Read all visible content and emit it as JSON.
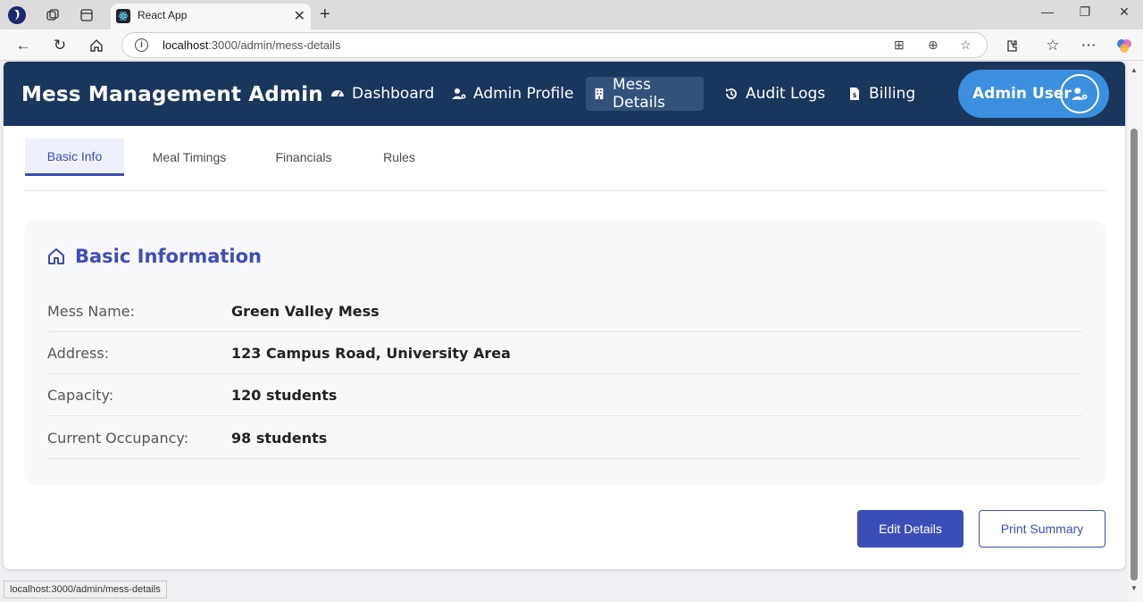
{
  "browser": {
    "tab_title": "React App",
    "url_host": "localhost",
    "url_rest": ":3000/admin/mess-details",
    "status_url": "localhost:3000/admin/mess-details"
  },
  "app": {
    "brand": "Mess Management Admin",
    "nav": [
      {
        "label": "Dashboard",
        "icon": "gauge-icon"
      },
      {
        "label": "Admin Profile",
        "icon": "user-gear-icon"
      },
      {
        "label": "Mess Details",
        "icon": "building-icon",
        "active": true
      },
      {
        "label": "Audit Logs",
        "icon": "history-icon"
      },
      {
        "label": "Billing",
        "icon": "invoice-icon"
      }
    ],
    "user": {
      "name": "Admin User",
      "icon": "user-gear-icon"
    }
  },
  "subtabs": [
    {
      "label": "Basic Info",
      "active": true
    },
    {
      "label": "Meal Timings"
    },
    {
      "label": "Financials"
    },
    {
      "label": "Rules"
    }
  ],
  "basic_info": {
    "title": "Basic Information",
    "rows": [
      {
        "label": "Mess Name:",
        "value": "Green Valley Mess"
      },
      {
        "label": "Address:",
        "value": "123 Campus Road, University Area"
      },
      {
        "label": "Capacity:",
        "value": "120 students"
      },
      {
        "label": "Current Occupancy:",
        "value": "98 students"
      }
    ]
  },
  "actions": {
    "edit": "Edit Details",
    "print": "Print Summary"
  },
  "colors": {
    "header": "#1b365d",
    "accent": "#3d4db7",
    "user_pill": "#3b8fde"
  }
}
